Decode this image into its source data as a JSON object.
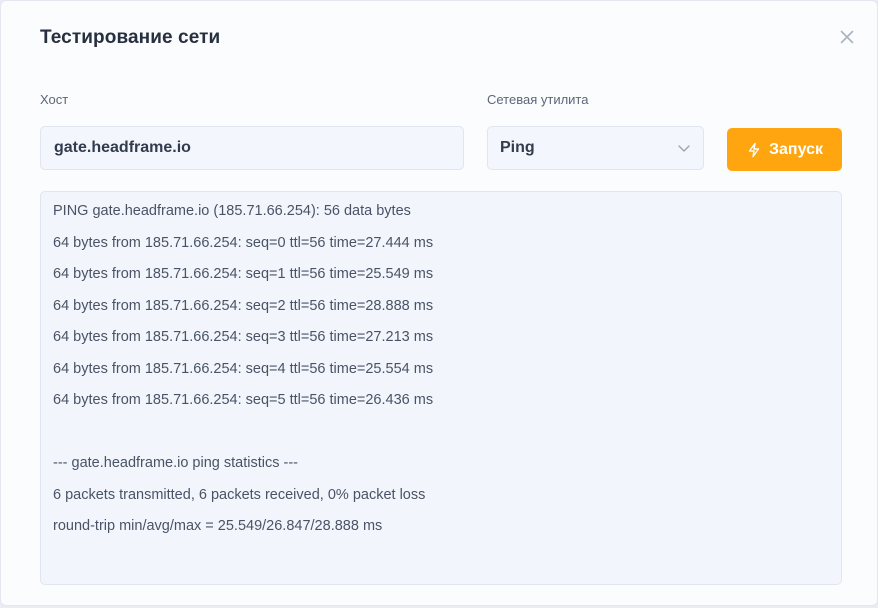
{
  "dialog": {
    "title": "Тестирование сети",
    "close_icon": "close-icon"
  },
  "form": {
    "host_label": "Хост",
    "host_value": "gate.headframe.io",
    "utility_label": "Сетевая утилита",
    "utility_value": "Ping",
    "utility_icon": "chevron-down-icon",
    "run_label": "Запуск",
    "run_icon": "bolt-icon"
  },
  "colors": {
    "accent": "#ffa50f",
    "panel": "#f2f6fc"
  },
  "output": {
    "lines": [
      "PING gate.headframe.io (185.71.66.254): 56 data bytes",
      "64 bytes from 185.71.66.254: seq=0 ttl=56 time=27.444 ms",
      "64 bytes from 185.71.66.254: seq=1 ttl=56 time=25.549 ms",
      "64 bytes from 185.71.66.254: seq=2 ttl=56 time=28.888 ms",
      "64 bytes from 185.71.66.254: seq=3 ttl=56 time=27.213 ms",
      "64 bytes from 185.71.66.254: seq=4 ttl=56 time=25.554 ms",
      "64 bytes from 185.71.66.254: seq=5 ttl=56 time=26.436 ms",
      "",
      "--- gate.headframe.io ping statistics ---",
      "6 packets transmitted, 6 packets received, 0% packet loss",
      "round-trip min/avg/max = 25.549/26.847/28.888 ms"
    ]
  }
}
